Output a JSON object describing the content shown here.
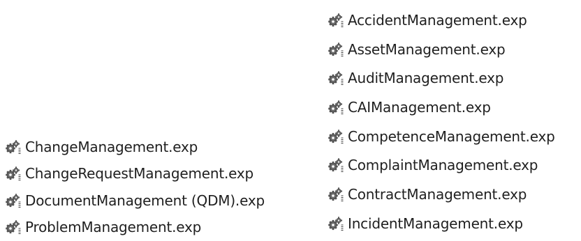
{
  "files": {
    "left_column": [
      {
        "name": "ChangeManagement.exp",
        "icon": "exp-file-icon"
      },
      {
        "name": "ChangeRequestManagement.exp",
        "icon": "exp-file-icon"
      },
      {
        "name": "DocumentManagement (QDM).exp",
        "icon": "exp-file-icon"
      },
      {
        "name": "ProblemManagement.exp",
        "icon": "exp-file-icon"
      }
    ],
    "right_column": [
      {
        "name": "AccidentManagement.exp",
        "icon": "exp-file-icon"
      },
      {
        "name": "AssetManagement.exp",
        "icon": "exp-file-icon"
      },
      {
        "name": "AuditManagement.exp",
        "icon": "exp-file-icon"
      },
      {
        "name": "CAIManagement.exp",
        "icon": "exp-file-icon"
      },
      {
        "name": "CompetenceManagement.exp",
        "icon": "exp-file-icon"
      },
      {
        "name": "ComplaintManagement.exp",
        "icon": "exp-file-icon"
      },
      {
        "name": "ContractManagement.exp",
        "icon": "exp-file-icon"
      },
      {
        "name": "IncidentManagement.exp",
        "icon": "exp-file-icon"
      }
    ]
  },
  "colors": {
    "text": "#1f1f1f",
    "icon_gear": "#6b6b6b",
    "icon_gear_dark": "#3c3c3c",
    "background": "#ffffff"
  }
}
